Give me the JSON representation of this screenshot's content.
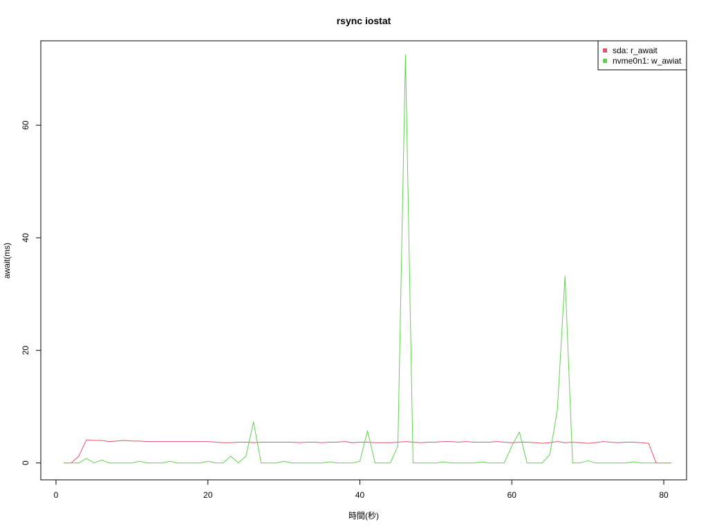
{
  "chart_data": {
    "type": "line",
    "title": "rsync iostat",
    "xlabel": "時間(秒)",
    "ylabel": "await(ms)",
    "xlim": [
      -2,
      83
    ],
    "ylim": [
      -3,
      75
    ],
    "xticks": [
      0,
      20,
      40,
      60,
      80
    ],
    "yticks": [
      0,
      20,
      40,
      60
    ],
    "legend_position": "top-right",
    "x": [
      1,
      2,
      3,
      4,
      5,
      6,
      7,
      8,
      9,
      10,
      11,
      12,
      13,
      14,
      15,
      16,
      17,
      18,
      19,
      20,
      21,
      22,
      23,
      24,
      25,
      26,
      27,
      28,
      29,
      30,
      31,
      32,
      33,
      34,
      35,
      36,
      37,
      38,
      39,
      40,
      41,
      42,
      43,
      44,
      45,
      46,
      47,
      48,
      49,
      50,
      51,
      52,
      53,
      54,
      55,
      56,
      57,
      58,
      59,
      60,
      61,
      62,
      63,
      64,
      65,
      66,
      67,
      68,
      69,
      70,
      71,
      72,
      73,
      74,
      75,
      76,
      77,
      78,
      79,
      80,
      81
    ],
    "series": [
      {
        "name": "sda: r_await",
        "color": "#DF536B",
        "values": [
          0,
          0,
          1.2,
          4.1,
          4.0,
          4.0,
          3.8,
          3.9,
          4.0,
          3.9,
          3.9,
          3.8,
          3.8,
          3.8,
          3.8,
          3.8,
          3.8,
          3.8,
          3.8,
          3.8,
          3.7,
          3.6,
          3.6,
          3.7,
          3.7,
          3.6,
          3.7,
          3.7,
          3.7,
          3.7,
          3.7,
          3.6,
          3.7,
          3.7,
          3.6,
          3.7,
          3.7,
          3.8,
          3.6,
          3.7,
          3.7,
          3.6,
          3.6,
          3.6,
          3.7,
          3.8,
          3.7,
          3.6,
          3.7,
          3.7,
          3.8,
          3.8,
          3.7,
          3.8,
          3.7,
          3.7,
          3.7,
          3.8,
          3.7,
          3.6,
          3.7,
          3.7,
          3.6,
          3.5,
          3.6,
          3.8,
          3.6,
          3.7,
          3.6,
          3.5,
          3.6,
          3.8,
          3.7,
          3.6,
          3.7,
          3.7,
          3.6,
          3.5,
          0,
          0,
          0
        ]
      },
      {
        "name": "nvme0n1: w_awiat",
        "color": "#61D04F",
        "values": [
          0,
          0,
          0,
          0.8,
          0,
          0.5,
          0,
          0,
          0,
          0,
          0.3,
          0,
          0,
          0,
          0.3,
          0,
          0,
          0,
          0,
          0.3,
          0,
          0,
          1.2,
          0,
          1.2,
          7.3,
          0,
          0,
          0,
          0.3,
          0,
          0,
          0,
          0,
          0,
          0.2,
          0,
          0,
          0,
          0.3,
          5.7,
          0,
          0,
          0,
          3.0,
          72.5,
          0,
          0,
          0,
          0,
          0.2,
          0,
          0,
          0,
          0,
          0.2,
          0,
          0,
          0,
          3.0,
          5.5,
          0,
          0,
          0,
          1.5,
          9.5,
          33.2,
          0,
          0,
          0.4,
          0,
          0,
          0,
          0,
          0,
          0.2,
          0,
          0,
          0,
          0,
          0
        ]
      }
    ]
  }
}
